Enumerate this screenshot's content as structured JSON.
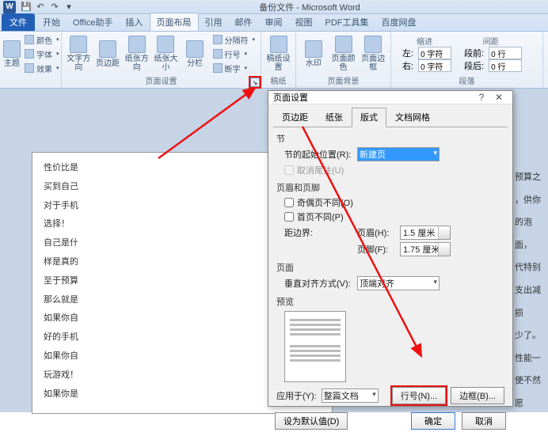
{
  "app": {
    "title": "备份文件 - Microsoft Word",
    "icon_text": "W"
  },
  "tabs": {
    "file": "文件",
    "items": [
      "开始",
      "Office助手",
      "插入",
      "页面布局",
      "引用",
      "邮件",
      "审阅",
      "视图",
      "PDF工具集",
      "百度网盘"
    ],
    "active_index": 3
  },
  "ribbon": {
    "themes_group": {
      "theme": "主题",
      "colors": "颜色",
      "fonts": "字体",
      "effects": "效果"
    },
    "page_setup": {
      "text_direction": "文字方向",
      "margins": "页边距",
      "orientation": "纸张方向",
      "size": "纸张大小",
      "columns": "分栏",
      "breaks": "分隔符",
      "line_numbers": "行号",
      "hyphenation": "断字",
      "label": "页面设置"
    },
    "manuscript": {
      "grid": "稿纸设置",
      "label": "稿纸"
    },
    "background": {
      "watermark": "水印",
      "color": "页面颜色",
      "borders": "页面边框",
      "label": "页面背景"
    },
    "paragraph": {
      "label": "段落",
      "indent_label": "缩进",
      "spacing_label": "间距",
      "left": "左:",
      "left_val": "0 字符",
      "right": "右:",
      "right_val": "0 字符",
      "before": "段前:",
      "before_val": "0 行",
      "after": "段后:",
      "after_val": "0 行"
    }
  },
  "doc": {
    "lines": [
      "性价比是",
      "买到自己",
      "对于手机",
      "选择！",
      "自己是什",
      "样是真的",
      "至于预算",
      "那么就是",
      "如果你自",
      "好的手机",
      "如果你自",
      "玩游戏！",
      "如果你是"
    ],
    "right_fragments": [
      "预算之",
      "，供你",
      "的泡面，",
      "代特别",
      "支出减损",
      "少了。",
      "性能一",
      "使不然愿"
    ]
  },
  "dialog": {
    "title": "页面设置",
    "tabs": [
      "页边距",
      "纸张",
      "版式",
      "文档网格"
    ],
    "active_tab": 2,
    "section": {
      "label": "节",
      "start": "节的起始位置(R):",
      "start_val": "新建页",
      "suppress": "取消尾注(U)"
    },
    "headers": {
      "label": "页眉和页脚",
      "odd_even": "奇偶页不同(O)",
      "first_diff": "首页不同(P)",
      "from_edge": "距边界:",
      "header": "页眉(H):",
      "header_val": "1.5 厘米",
      "footer": "页脚(F):",
      "footer_val": "1.75 厘米"
    },
    "page": {
      "label": "页面",
      "valign": "垂直对齐方式(V):",
      "valign_val": "顶端对齐"
    },
    "preview": "预览",
    "apply_to": "应用于(Y):",
    "apply_val": "整篇文档",
    "line_numbers_btn": "行号(N)...",
    "borders_btn": "边框(B)...",
    "set_default": "设为默认值(D)",
    "ok": "确定",
    "cancel": "取消"
  }
}
